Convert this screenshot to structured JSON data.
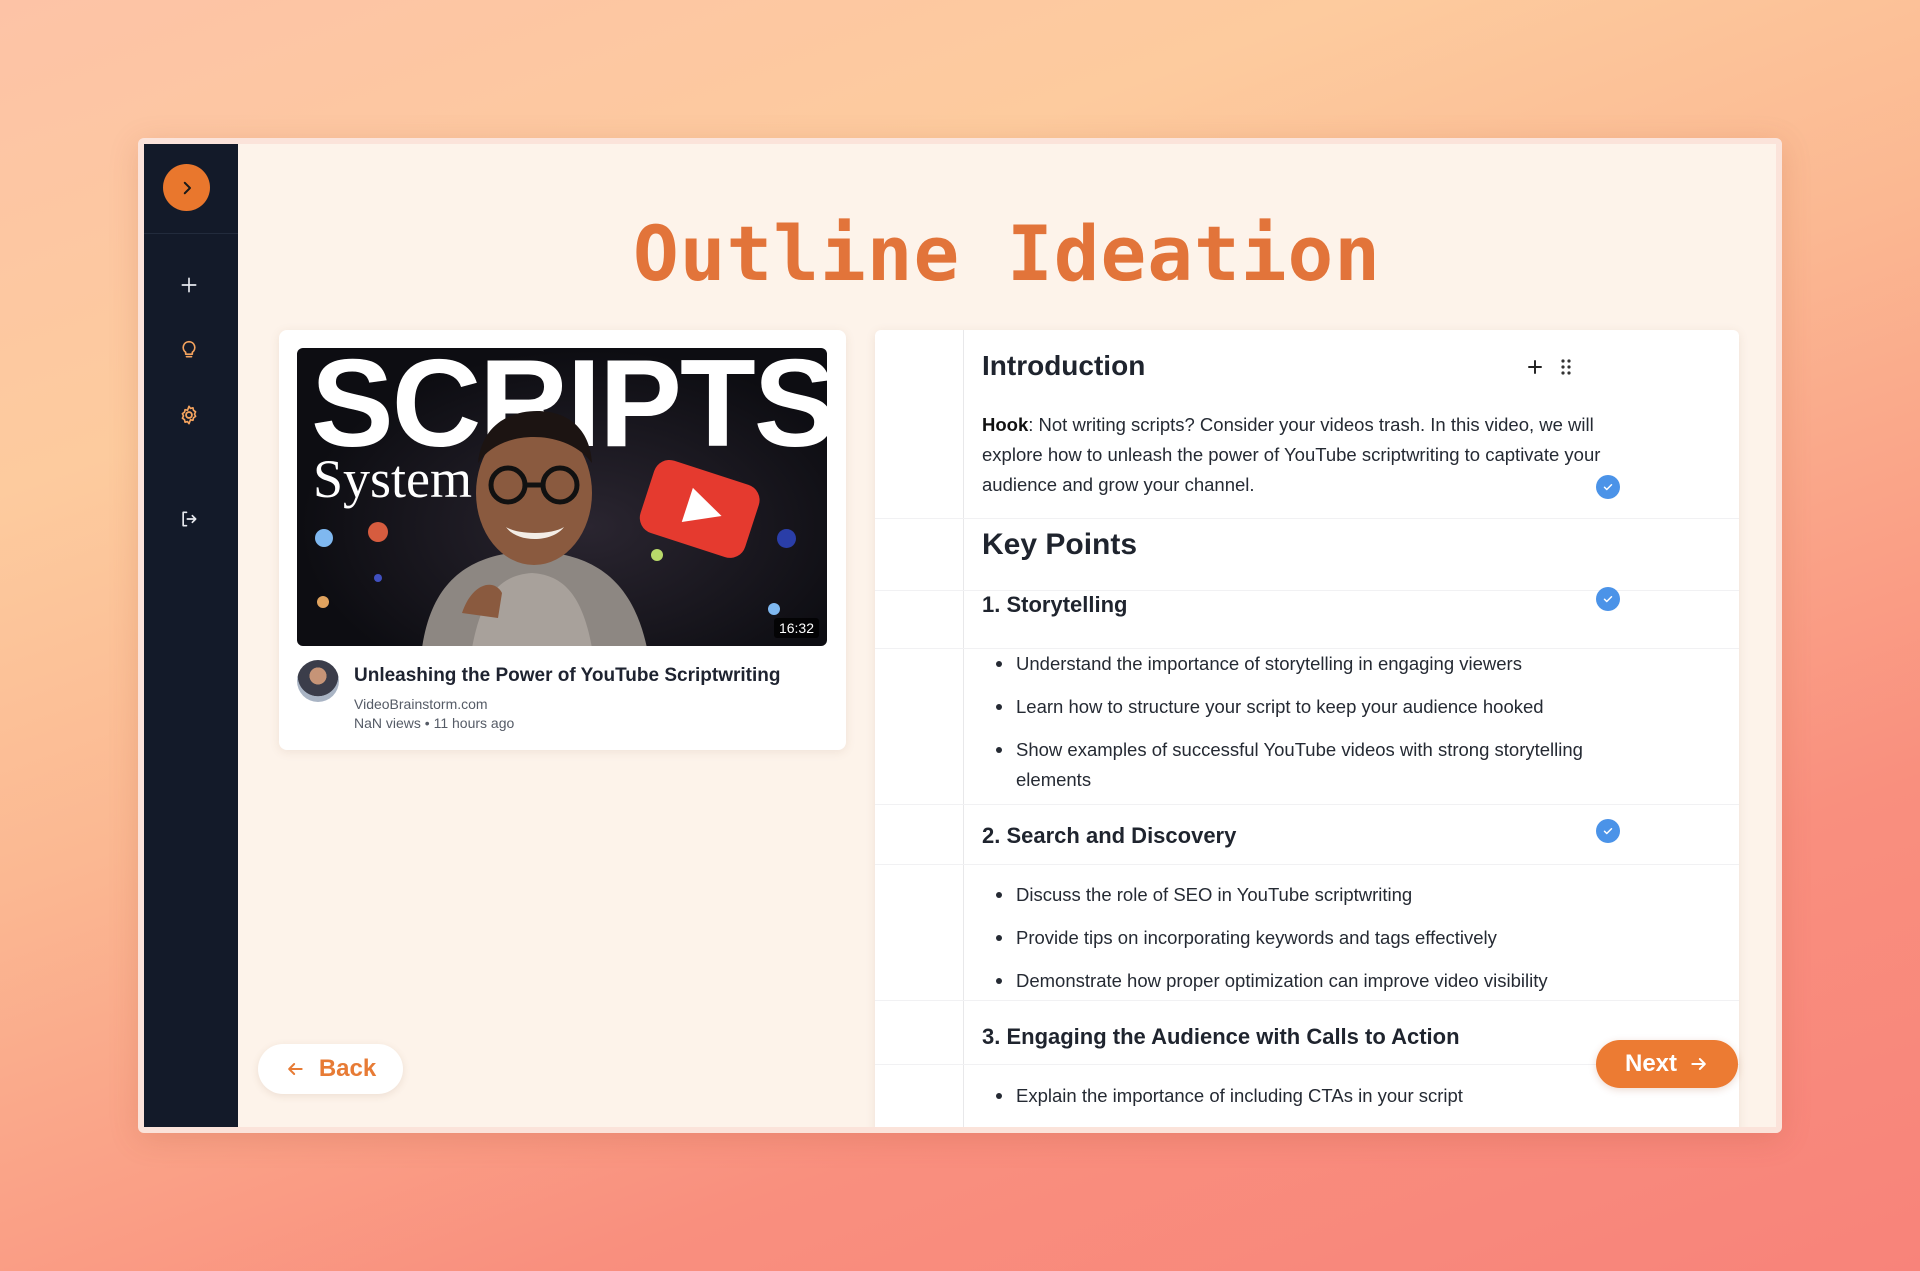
{
  "page": {
    "title": "Outline Ideation"
  },
  "sidebar": {
    "items": [
      {
        "icon": "plus-icon"
      },
      {
        "icon": "lightbulb-icon"
      },
      {
        "icon": "gear-icon"
      },
      {
        "icon": "logout-icon"
      }
    ],
    "toggle_icon": "chevron-right-icon"
  },
  "video": {
    "thumbnail_text_main": "SCRIPTS",
    "thumbnail_text_sub": "System",
    "duration": "16:32",
    "title": "Unleashing the Power of YouTube Scriptwriting",
    "channel": "VideoBrainstorm.com",
    "stats": "NaN views • 11 hours ago"
  },
  "outline": {
    "intro_heading": "Introduction",
    "hook_label": "Hook",
    "hook_text": ": Not writing scripts? Consider your videos trash. In this video, we will explore how to unleash the power of YouTube scriptwriting to captivate your audience and grow your channel.",
    "key_points_heading": "Key Points",
    "sections": [
      {
        "heading": "1. Storytelling",
        "bullets": [
          "Understand the importance of storytelling in engaging viewers",
          "Learn how to structure your script to keep your audience hooked",
          "Show examples of successful YouTube videos with strong storytelling elements"
        ]
      },
      {
        "heading": "2. Search and Discovery",
        "bullets": [
          "Discuss the role of SEO in YouTube scriptwriting",
          "Provide tips on incorporating keywords and tags effectively",
          "Demonstrate how proper optimization can improve video visibility"
        ]
      },
      {
        "heading": "3. Engaging the Audience with Calls to Action",
        "bullets": [
          "Explain the importance of including CTAs in your script"
        ]
      }
    ]
  },
  "nav": {
    "back_label": "Back",
    "next_label": "Next"
  },
  "colors": {
    "accent": "#e9772d",
    "sidebar_bg": "#131a29",
    "check": "#4b93e8",
    "title": "#e2743a"
  }
}
